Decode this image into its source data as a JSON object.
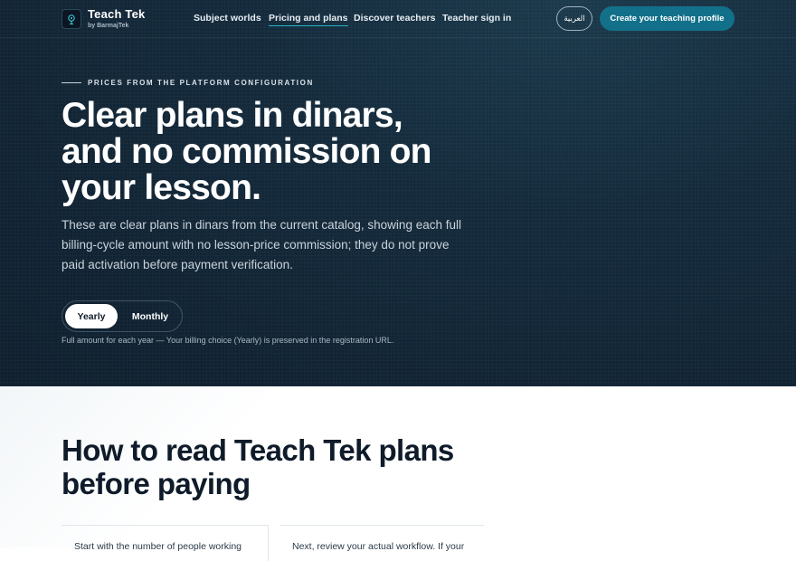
{
  "brand": {
    "name": "Teach Tek",
    "subtitle": "by BarmajTek"
  },
  "nav": {
    "links": [
      {
        "label": "Subject worlds",
        "active": false
      },
      {
        "label": "Pricing and plans",
        "active": true
      },
      {
        "label": "Discover teachers",
        "active": false
      },
      {
        "label": "Teacher sign in",
        "active": false
      }
    ],
    "language_label": "العربية",
    "cta_label": "Create your teaching profile"
  },
  "hero": {
    "eyebrow": "PRICES FROM THE PLATFORM CONFIGURATION",
    "title": "Clear plans in dinars, and no commission on your lesson.",
    "description": "These are clear plans in dinars from the current catalog, showing each full billing-cycle amount with no lesson-price commission; they do not prove paid activation before payment verification.",
    "billing_toggle": {
      "options": [
        "Yearly",
        "Monthly"
      ],
      "selected": "Yearly"
    },
    "billing_note": "Full amount for each year — Your billing choice (Yearly) is preserved in the registration URL."
  },
  "guide": {
    "title": "How to read Teach Tek plans before paying",
    "cards": [
      {
        "text": "Start with the number of people working"
      },
      {
        "text": "Next, review your actual workflow. If your"
      }
    ]
  },
  "colors": {
    "hero_bg": "#142a3b",
    "accent": "#12708a",
    "active_underline": "#22b5c9"
  }
}
